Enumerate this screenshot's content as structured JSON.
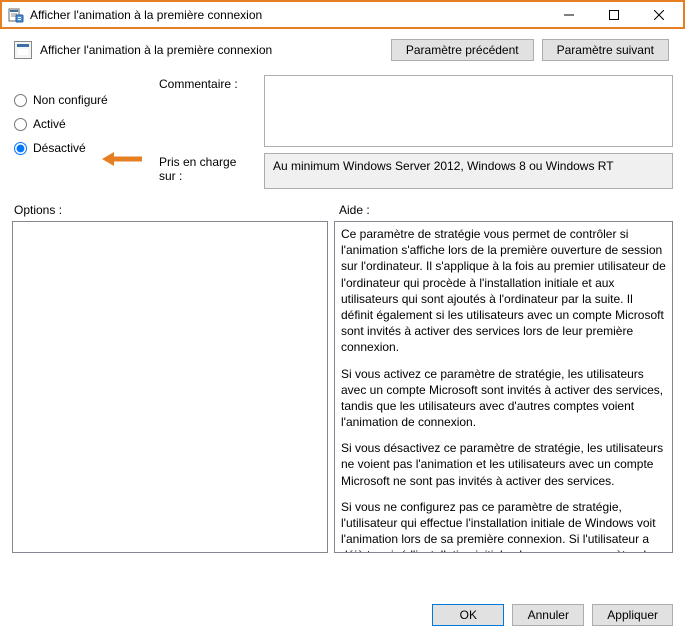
{
  "window": {
    "title": "Afficher l'animation à la première connexion"
  },
  "header": {
    "subtitle": "Afficher l'animation à la première connexion",
    "prev_button": "Paramètre précédent",
    "next_button": "Paramètre suivant"
  },
  "radios": {
    "not_configured": "Non configuré",
    "enabled": "Activé",
    "disabled": "Désactivé",
    "selected": "disabled"
  },
  "labels": {
    "comment": "Commentaire :",
    "supported_on": "Pris en charge sur :",
    "options": "Options :",
    "help": "Aide :"
  },
  "fields": {
    "comment_value": "",
    "supported_on_value": "Au minimum Windows Server 2012, Windows 8 ou Windows RT"
  },
  "help_text": {
    "p1": "Ce paramètre de stratégie vous permet de contrôler si l'animation s'affiche lors de la première ouverture de session sur l'ordinateur.  Il s'applique à la fois au premier utilisateur de l'ordinateur qui procède à l'installation initiale et aux utilisateurs qui sont ajoutés à l'ordinateur par la suite.  Il définit également si les utilisateurs avec un compte Microsoft sont invités à activer des services lors de leur première connexion.",
    "p2": "Si vous activez ce paramètre de stratégie, les utilisateurs avec un compte Microsoft sont invités à activer des services, tandis que les utilisateurs avec d'autres comptes voient l'animation de connexion.",
    "p3": "Si vous désactivez ce paramètre de stratégie, les utilisateurs ne voient pas l'animation et les utilisateurs avec un compte Microsoft ne sont pas invités à activer des services.",
    "p4": "Si vous ne configurez pas ce paramètre de stratégie, l'utilisateur qui effectue l'installation initiale de Windows voit l'animation lors de sa première connexion. Si l'utilisateur a déjà terminé l'installation initiale alors que ce paramètre de stratégie n'est pas"
  },
  "buttons": {
    "ok": "OK",
    "cancel": "Annuler",
    "apply": "Appliquer"
  }
}
